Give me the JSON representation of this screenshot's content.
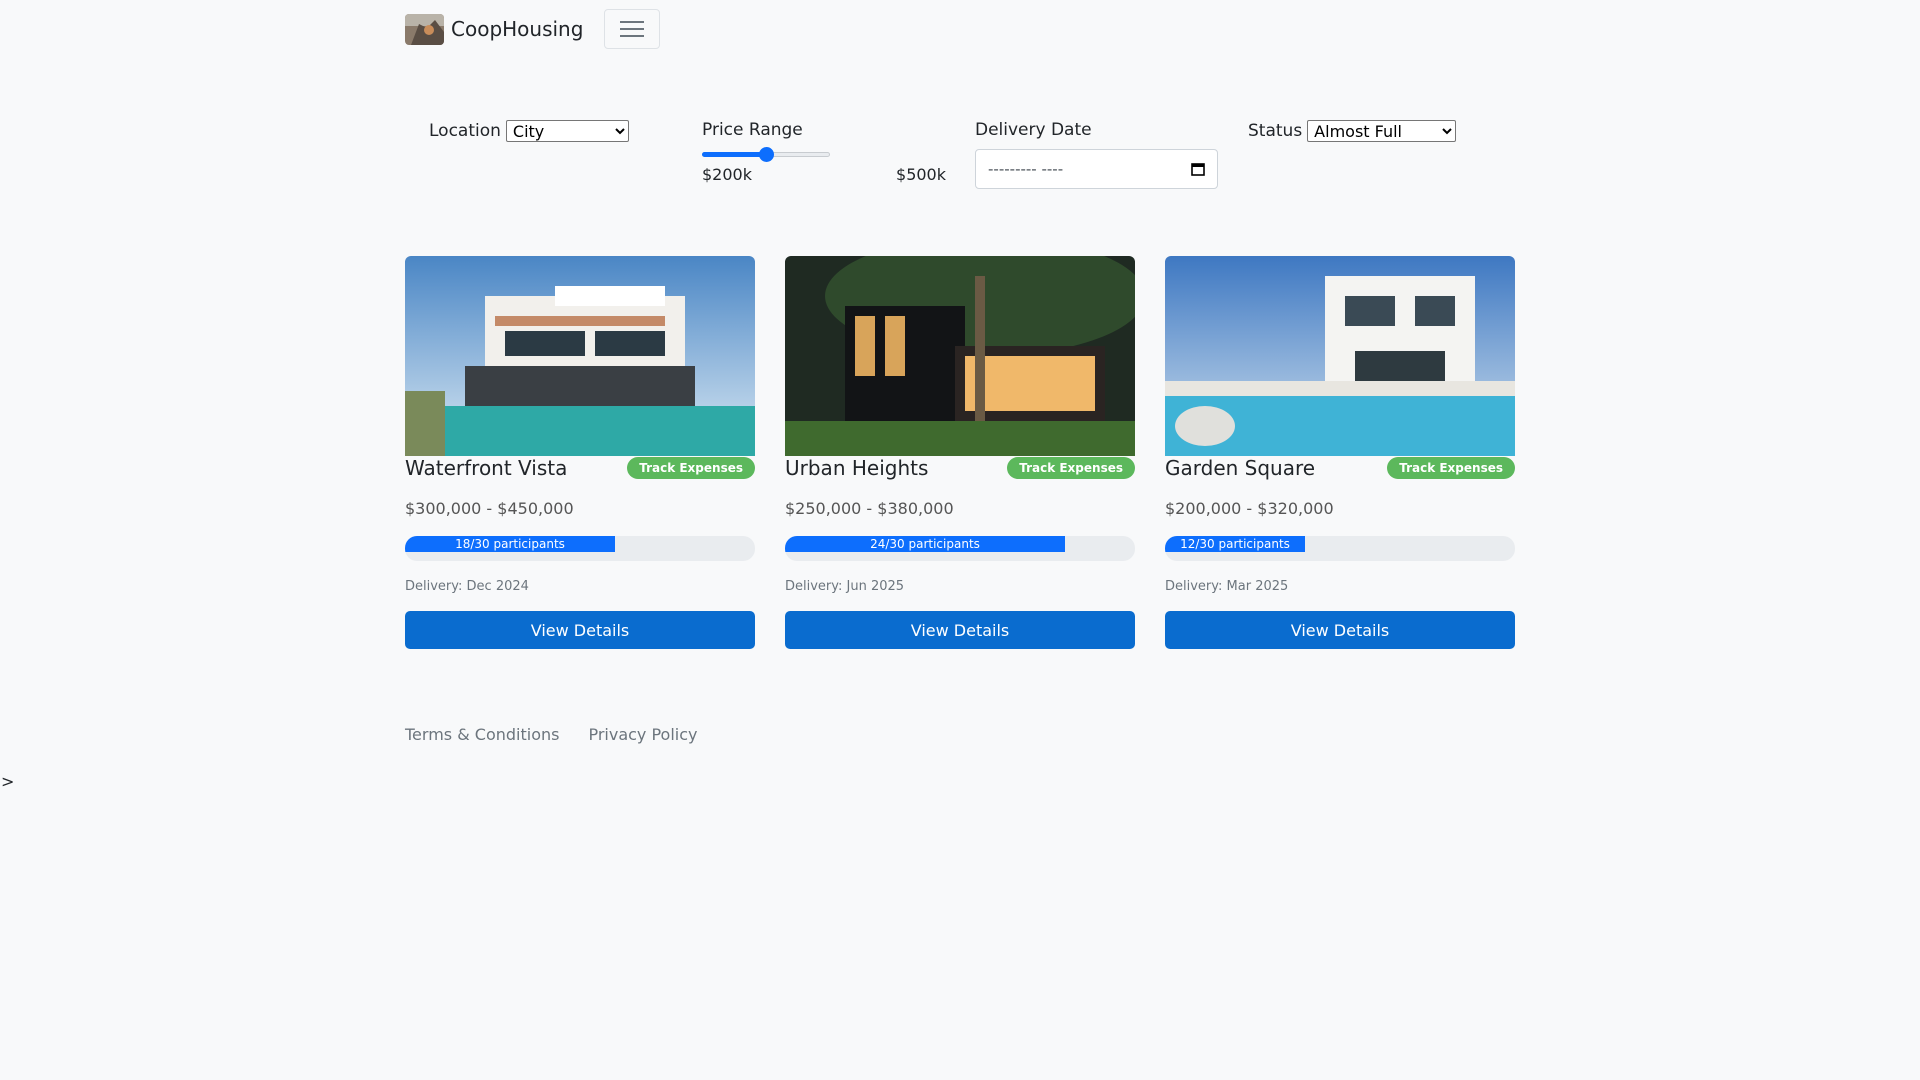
{
  "brand": {
    "name": "CoopHousing"
  },
  "filters": {
    "location_label": "Location",
    "location_value": "City",
    "price_label": "Price Range",
    "price_min": "$200k",
    "price_max": "$500k",
    "price_level": 0.5,
    "date_label": "Delivery Date",
    "date_placeholder": "--------- ----",
    "status_label": "Status",
    "status_value": "Almost Full"
  },
  "projects": [
    {
      "title": "Waterfront Vista",
      "badge": "Track Expenses",
      "price": "$300,000 - $450,000",
      "participants_text": "18/30 participants",
      "filled": 18,
      "total": 30,
      "delivery": "Delivery: Dec 2024",
      "button": "View Details"
    },
    {
      "title": "Urban Heights",
      "badge": "Track Expenses",
      "price": "$250,000 - $380,000",
      "participants_text": "24/30 participants",
      "filled": 24,
      "total": 30,
      "delivery": "Delivery: Jun 2025",
      "button": "View Details"
    },
    {
      "title": "Garden Square",
      "badge": "Track Expenses",
      "price": "$200,000 - $320,000",
      "participants_text": "12/30 participants",
      "filled": 12,
      "total": 30,
      "delivery": "Delivery: Mar 2025",
      "button": "View Details"
    }
  ],
  "footer": {
    "terms": "Terms & Conditions",
    "privacy": "Privacy Policy"
  },
  "stray_text": ">",
  "icons": {
    "menu": "hamburger-icon",
    "calendar": "calendar-icon",
    "logo": "brand-logo-icon"
  },
  "colors": {
    "primary": "#0d6efd",
    "badge": "#5cb85c",
    "background": "#f8f9fa"
  }
}
